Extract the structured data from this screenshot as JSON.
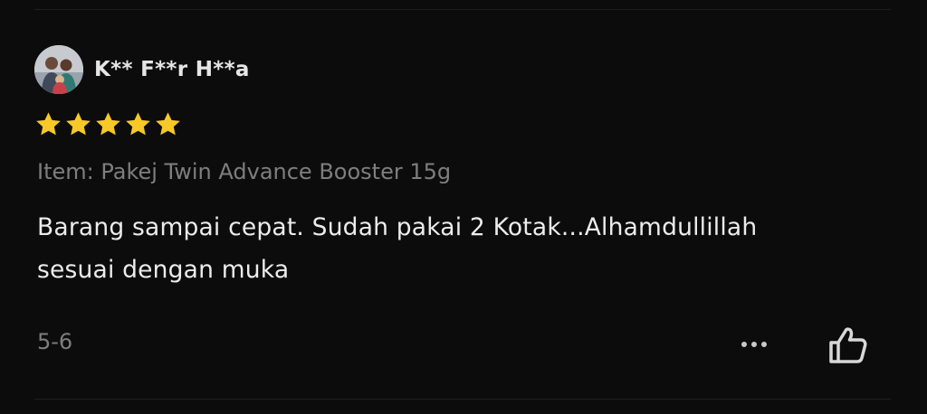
{
  "review": {
    "username": "K** F**r H**a",
    "rating": 5,
    "rating_max": 5,
    "item_variant": "Item: Pakej Twin Advance Booster 15g",
    "comment_line1": "Barang sampai cepat. Sudah pakai 2 Kotak...Alhamdullillah",
    "comment_line2": "sesuai dengan muka",
    "date": "5-6"
  },
  "icons": {
    "avatar": "user-photo-avatar",
    "star": "star-icon",
    "more": "more-horizontal-icon",
    "like": "thumbs-up-icon"
  },
  "colors": {
    "background": "#0c0c0d",
    "star": "#f6c928",
    "primary_text": "#ececec",
    "secondary_text": "#7e7e7e"
  }
}
